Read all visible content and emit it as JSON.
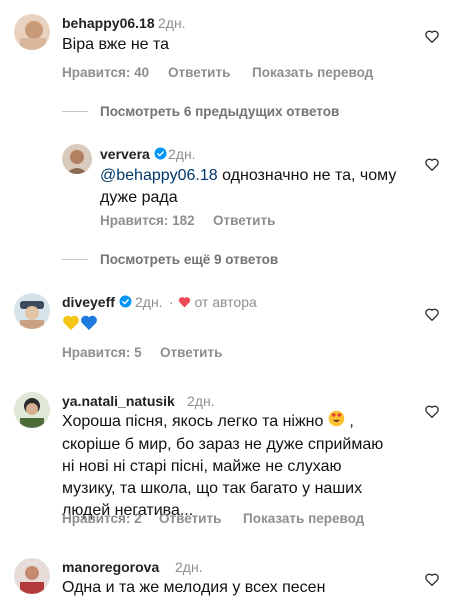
{
  "comments": [
    {
      "username": "behappy06.18",
      "time": "2дн.",
      "text": "Віра вже не та",
      "likes_label": "Нравится: 40",
      "reply_label": "Ответить",
      "translate_label": "Показать перевод"
    },
    {
      "username": "ververa",
      "time": "2дн.",
      "mention": "@behappy06.18",
      "text_line1": " однозначно не та, чому",
      "text_line2": "дуже рада",
      "likes_label": "Нравится: 182",
      "reply_label": "Ответить"
    },
    {
      "username": "diveyeff",
      "time": "2дн.",
      "author_label": "от автора",
      "likes_label": "Нравится: 5",
      "reply_label": "Ответить"
    },
    {
      "username": "ya.natali_natusik",
      "time": "2дн.",
      "text_line1": "Хороша пісня, якось легко та ніжно",
      "text_line2": "скоріше б мир, бо зараз  не дуже  сприймаю",
      "text_line3": "ні нові ні  старі пісні,   майже  не слухаю",
      "text_line4": "музику,   та школа, що так багато  у наших",
      "text_line5": "людей  негатива...",
      "likes_label": "Нравится: 2",
      "reply_label": "Ответить",
      "translate_label": "Показать перевод"
    },
    {
      "username": "manoregorova",
      "time": "2дн.",
      "text": "Одна и та же мелодия у всех песен"
    }
  ],
  "view_previous": "Посмотреть 6 предыдущих ответов",
  "view_more": "Посмотреть ещё 9 ответов",
  "colors": {
    "verified": "#0095f6",
    "heart_red": "#ed4956",
    "mention": "#00376b",
    "secondary": "#8e8e8e"
  }
}
